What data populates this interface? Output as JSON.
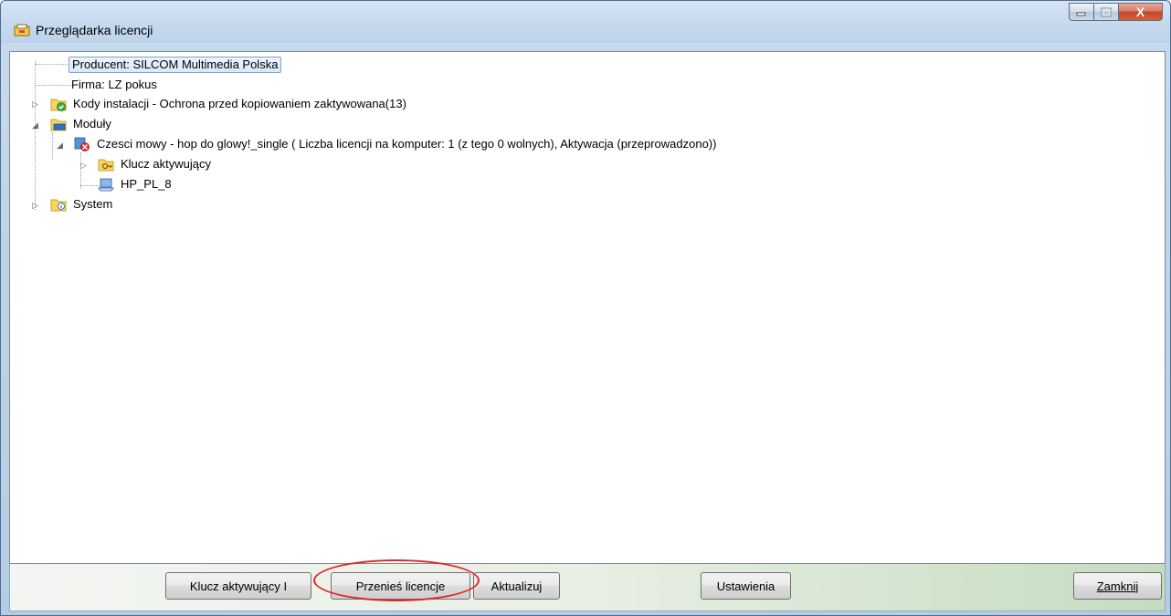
{
  "window": {
    "title": "Przeglądarka licencji",
    "caption_buttons": {
      "minimize": "minimize-icon",
      "maximize": "maximize-icon",
      "close_glyph": "X"
    }
  },
  "tree": {
    "producent": "Producent: SILCOM Multimedia Polska",
    "firma": "Firma: LZ pokus",
    "kody": "Kody instalacji - Ochrona przed kopiowaniem zaktywowana(13)",
    "moduly": "Moduły",
    "modul_item": "Czesci mowy - hop do glowy!_single ( Liczba licencji na komputer: 1 (z tego 0 wolnych), Aktywacja (przeprowadzono))",
    "klucz": "Klucz aktywujący",
    "hp": "HP_PL_8",
    "system": "System"
  },
  "buttons": {
    "klucz_aktywujacy": "Klucz aktywujący I",
    "przenies": "Przenieś licencje",
    "aktualizuj": "Aktualizuj",
    "ustawienia": "Ustawienia",
    "zamknij": "Zamknij"
  },
  "colors": {
    "highlight_ring": "#e0262a",
    "selection": "#d9e9f9",
    "close_button": "#c44428"
  }
}
